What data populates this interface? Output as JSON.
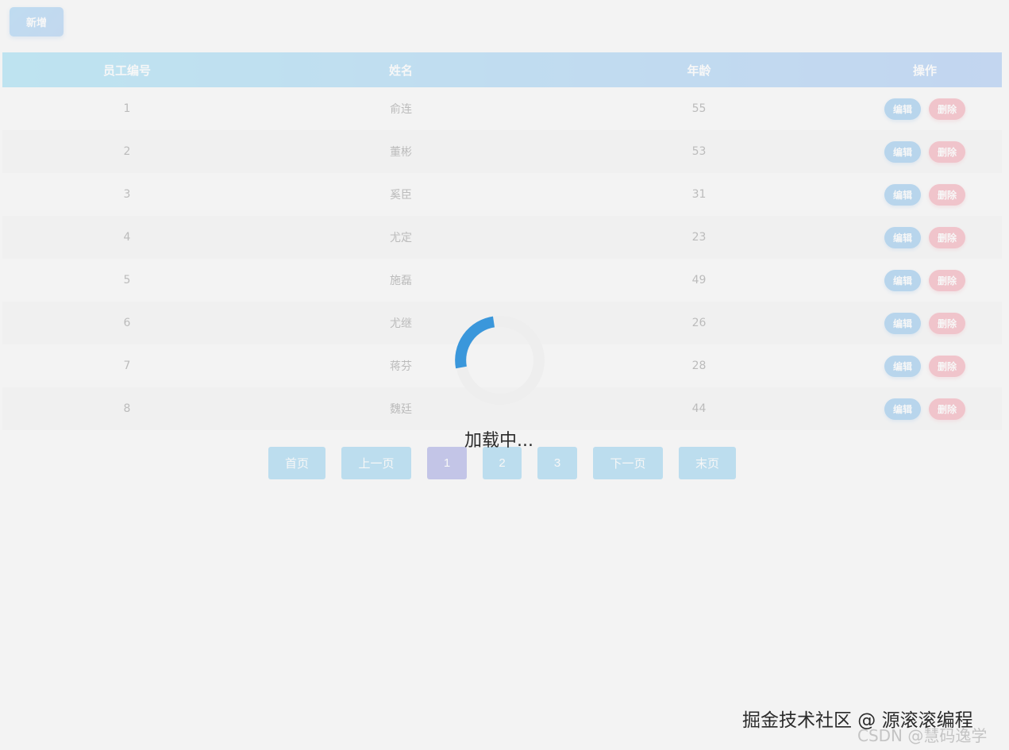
{
  "toolbar": {
    "add_label": "新增"
  },
  "table": {
    "headers": [
      "员工编号",
      "姓名",
      "年龄",
      "操作"
    ],
    "rows": [
      {
        "id": "1",
        "name": "俞连",
        "age": "55"
      },
      {
        "id": "2",
        "name": "董彬",
        "age": "53"
      },
      {
        "id": "3",
        "name": "奚臣",
        "age": "31"
      },
      {
        "id": "4",
        "name": "尤定",
        "age": "23"
      },
      {
        "id": "5",
        "name": "施磊",
        "age": "49"
      },
      {
        "id": "6",
        "name": "尤继",
        "age": "26"
      },
      {
        "id": "7",
        "name": "蒋芬",
        "age": "28"
      },
      {
        "id": "8",
        "name": "魏廷",
        "age": "44"
      }
    ],
    "edit_label": "编辑",
    "delete_label": "删除"
  },
  "pagination": {
    "first": "首页",
    "prev": "上一页",
    "pages": [
      "1",
      "2",
      "3"
    ],
    "active_page": "1",
    "next": "下一页",
    "last": "末页"
  },
  "loading": {
    "text": "加载中..."
  },
  "watermark": {
    "juejin": "掘金技术社区 @ 源滚滚编程",
    "csdn": "CSDN @慧码逸学"
  },
  "colors": {
    "header_gradient_start": "#5cc6ea",
    "header_gradient_end": "#6aa0ea",
    "edit_button": "#4a9fe0",
    "delete_button": "#ec6e80",
    "pager_button": "#57b6e4",
    "pager_active": "#6a6fd0",
    "spinner_arc": "#3a97db"
  }
}
